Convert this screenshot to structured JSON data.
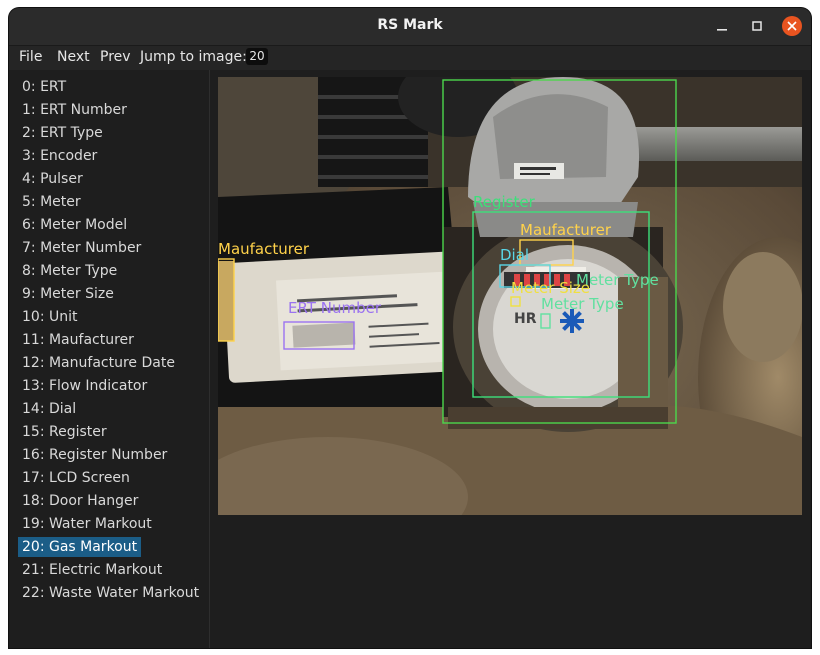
{
  "window": {
    "title": "RS Mark"
  },
  "menu": {
    "file": "File",
    "next": "Next",
    "prev": "Prev",
    "jump_label": "Jump to image:",
    "jump_value": "20"
  },
  "labels": [
    "0: ERT",
    "1: ERT Number",
    "2: ERT Type",
    "3: Encoder",
    "4: Pulser",
    "5: Meter",
    "6: Meter Model",
    "7: Meter Number",
    "8: Meter Type",
    "9: Meter Size",
    "10: Unit",
    "11: Maufacturer",
    "12: Manufacture Date",
    "13: Flow Indicator",
    "14: Dial",
    "15: Register",
    "16: Register Number",
    "17: LCD Screen",
    "18: Door Hanger",
    "19: Water Markout",
    "20: Gas Markout",
    "21: Electric Markout",
    "22: Waste Water Markout"
  ],
  "selected_label": "20: Gas Markout",
  "annotations": {
    "register": "Register",
    "maufacturer_left": "Maufacturer",
    "maufacturer_right": "Maufacturer",
    "dial": "Dial",
    "meter_type_1": "Meter Type",
    "meter_type_2": "Meter Type",
    "meter_size": "Meter Size",
    "ert_number": "ERT Number"
  },
  "colors": {
    "meter_box": "#4cd64c",
    "register": "#3de07a",
    "maufacturer": "#ffd24a",
    "dial": "#5ad6e6",
    "meter_type": "#61e0a0",
    "meter_size": "#f0e040",
    "ert_number": "#9b73f0",
    "selected": "#1b5d87"
  }
}
